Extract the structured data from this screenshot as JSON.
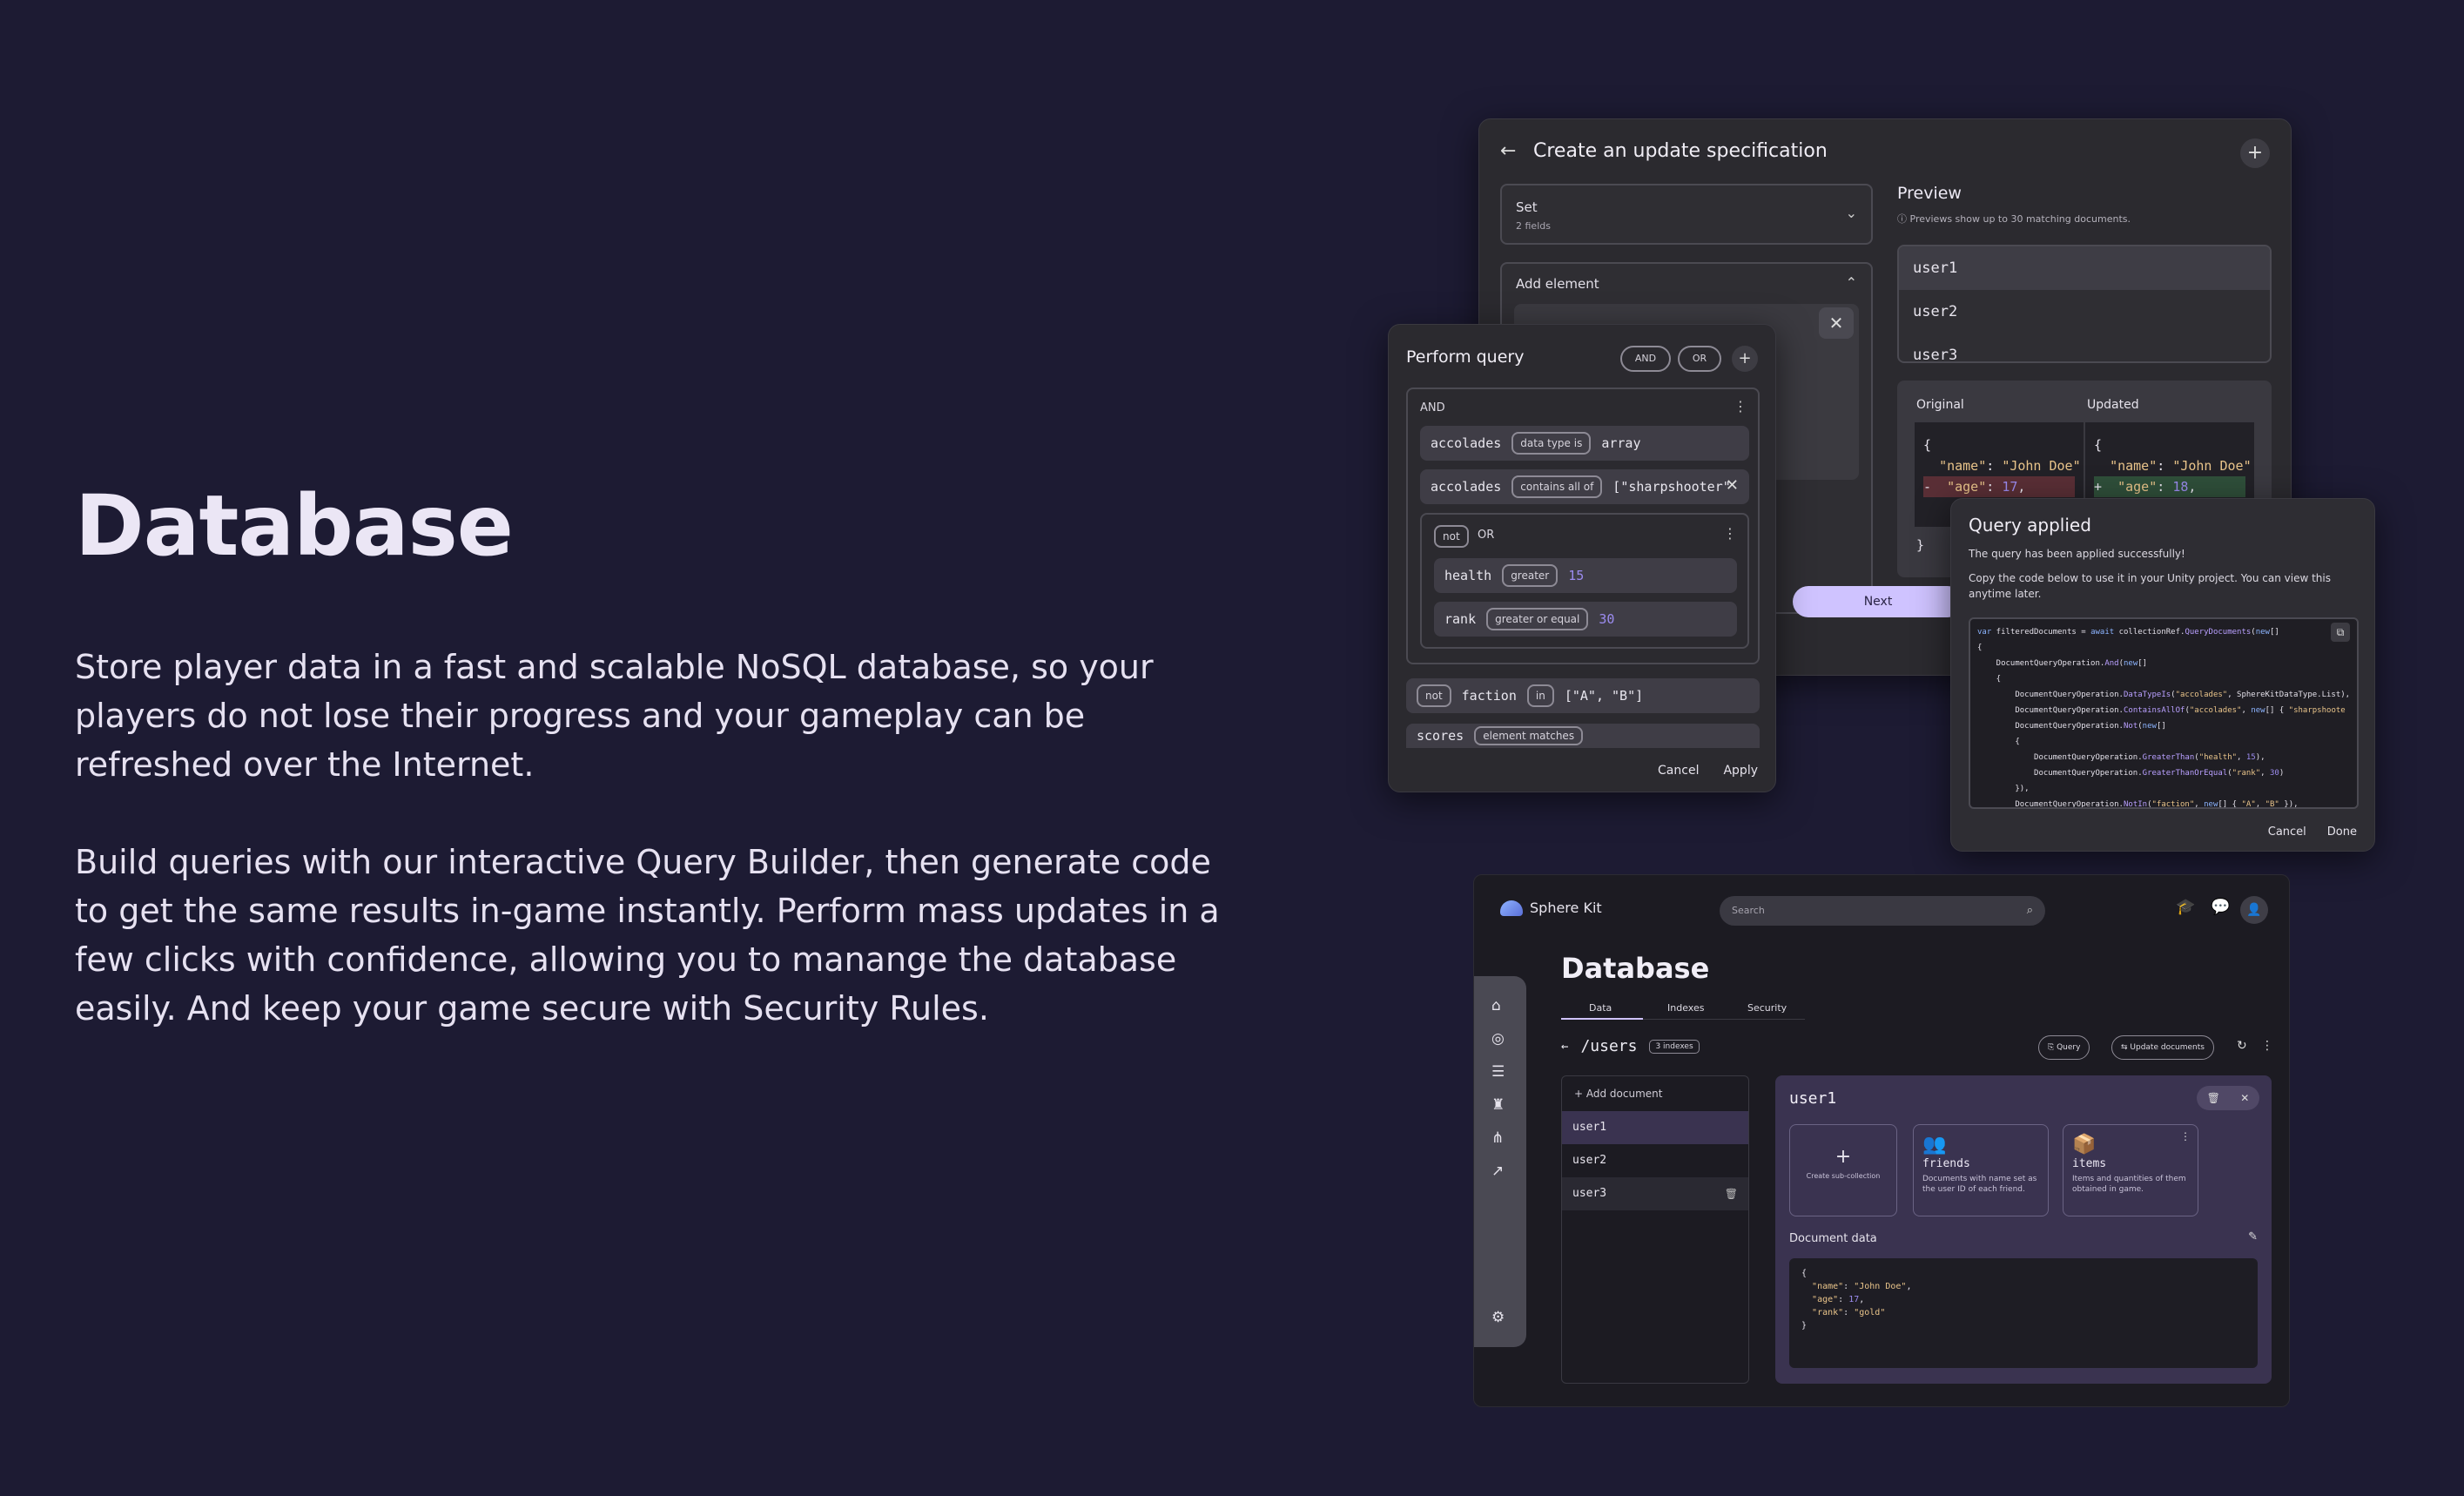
{
  "hero": {
    "title": "Database",
    "paragraph1": "Store player data in a fast and scalable NoSQL database, so your players do not lose their progress and your gameplay can be refreshed over the Internet.",
    "paragraph2": "Build queries with our interactive Query Builder, then generate code to get the same results in-game instantly. Perform mass updates in a few clicks with confidence, allowing you to manange the database easily. And keep your game secure with Security Rules."
  },
  "spec": {
    "title": "Create an update specification",
    "select_label": "Set",
    "select_sub": "2 fields",
    "add_element_label": "Add element",
    "preview_title": "Preview",
    "preview_note": "Previews show up to 30 matching documents.",
    "preview_items": [
      "user1",
      "user2",
      "user3"
    ],
    "original_label": "Original",
    "updated_label": "Updated",
    "next_label": "Next"
  },
  "query": {
    "title": "Perform query",
    "and_label": "AND",
    "or_label": "OR",
    "group_label": "AND",
    "rows": [
      {
        "field": "accolades",
        "op": "data type is",
        "value": "array"
      },
      {
        "field": "accolades",
        "op": "contains all of",
        "value": "[\"sharpshooter\", \""
      }
    ],
    "not_label": "not",
    "or_group_label": "OR",
    "or_rows": [
      {
        "field": "health",
        "op": "greater",
        "value": "15"
      },
      {
        "field": "rank",
        "op": "greater or equal",
        "value": "30"
      }
    ],
    "faction_row": {
      "not": "not",
      "field": "faction",
      "op": "in",
      "value": "[\"A\", \"B\"]"
    },
    "scores_row": {
      "field": "scores",
      "op": "element matches"
    },
    "cancel_label": "Cancel",
    "apply_label": "Apply"
  },
  "applied": {
    "title": "Query applied",
    "msg1": "The query has been applied successfully!",
    "msg2": "Copy the code below to use it in your Unity project. You can view this anytime later.",
    "cancel_label": "Cancel",
    "done_label": "Done"
  },
  "dash": {
    "brand": "Sphere Kit",
    "search_placeholder": "Search",
    "page_title": "Database",
    "tabs": [
      "Data",
      "Indexes",
      "Security"
    ],
    "path": "/users",
    "index_count": "3 indexes",
    "query_btn": "Query",
    "update_btn": "Update documents",
    "add_document": "Add document",
    "documents": [
      "user1",
      "user2",
      "user3"
    ],
    "doc_name": "user1",
    "create_sub": "Create sub-collection",
    "collections": [
      {
        "name": "friends",
        "desc": "Documents with name set as the user ID of each friend."
      },
      {
        "name": "items",
        "desc": "Items and quantities of them obtained in game."
      }
    ],
    "doc_data_label": "Document data"
  }
}
